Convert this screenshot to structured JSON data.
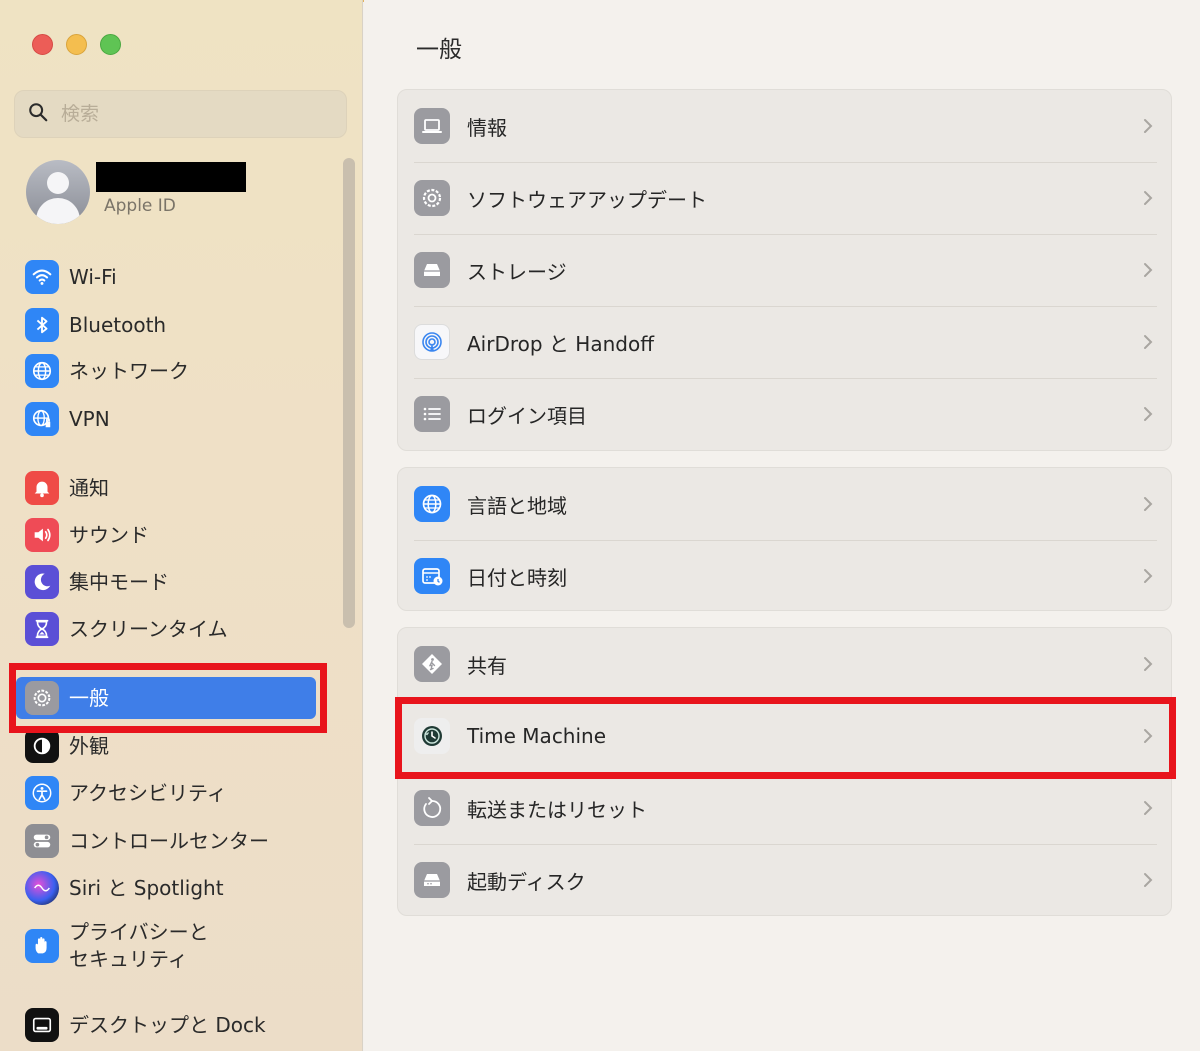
{
  "window": {
    "title": "一般"
  },
  "sidebar": {
    "search_placeholder": "検索",
    "account": {
      "subtitle": "Apple ID"
    },
    "items": [
      {
        "label": "Wi-Fi",
        "icon": "wifi-icon",
        "color": "#2f86f6"
      },
      {
        "label": "Bluetooth",
        "icon": "bluetooth-icon",
        "color": "#2f86f6"
      },
      {
        "label": "ネットワーク",
        "icon": "globe-icon",
        "color": "#2f86f6"
      },
      {
        "label": "VPN",
        "icon": "vpn-globe-icon",
        "color": "#2f86f6"
      },
      {
        "label": "通知",
        "icon": "bell-icon",
        "color": "#ef4b46"
      },
      {
        "label": "サウンド",
        "icon": "speaker-icon",
        "color": "#ef4b56"
      },
      {
        "label": "集中モード",
        "icon": "moon-icon",
        "color": "#5b4fd6"
      },
      {
        "label": "スクリーンタイム",
        "icon": "hourglass-icon",
        "color": "#5b4fd6"
      },
      {
        "label": "一般",
        "icon": "gear-icon",
        "color": "#8e8e93",
        "selected": true
      },
      {
        "label": "外観",
        "icon": "appearance-icon",
        "color": "#111111"
      },
      {
        "label": "アクセシビリティ",
        "icon": "accessibility-icon",
        "color": "#2f86f6"
      },
      {
        "label": "コントロールセンター",
        "icon": "toggles-icon",
        "color": "#8e8e93"
      },
      {
        "label": "Siri と Spotlight",
        "icon": "siri-icon",
        "color": "#222222"
      },
      {
        "label": "プライバシーと",
        "label2": "セキュリティ",
        "icon": "hand-icon",
        "color": "#2f86f6"
      },
      {
        "label": "デスクトップと Dock",
        "icon": "dock-icon",
        "color": "#111111"
      }
    ]
  },
  "main": {
    "title": "一般",
    "groups": [
      {
        "rows": [
          {
            "label": "情報",
            "icon": "laptop-icon"
          },
          {
            "label": "ソフトウェアアップデート",
            "icon": "software-update-icon"
          },
          {
            "label": "ストレージ",
            "icon": "storage-icon"
          },
          {
            "label": "AirDrop と Handoff",
            "icon": "airdrop-icon"
          },
          {
            "label": "ログイン項目",
            "icon": "list-icon"
          }
        ]
      },
      {
        "rows": [
          {
            "label": "言語と地域",
            "icon": "language-globe-icon"
          },
          {
            "label": "日付と時刻",
            "icon": "calendar-clock-icon"
          }
        ]
      },
      {
        "rows": [
          {
            "label": "共有",
            "icon": "sharing-icon"
          },
          {
            "label": "Time Machine",
            "icon": "time-machine-icon"
          },
          {
            "label": "転送またはリセット",
            "icon": "reset-icon"
          },
          {
            "label": "起動ディスク",
            "icon": "startup-disk-icon"
          }
        ]
      }
    ]
  },
  "colors": {
    "selection": "#3f7ee8",
    "highlight_box": "#e8141c"
  }
}
